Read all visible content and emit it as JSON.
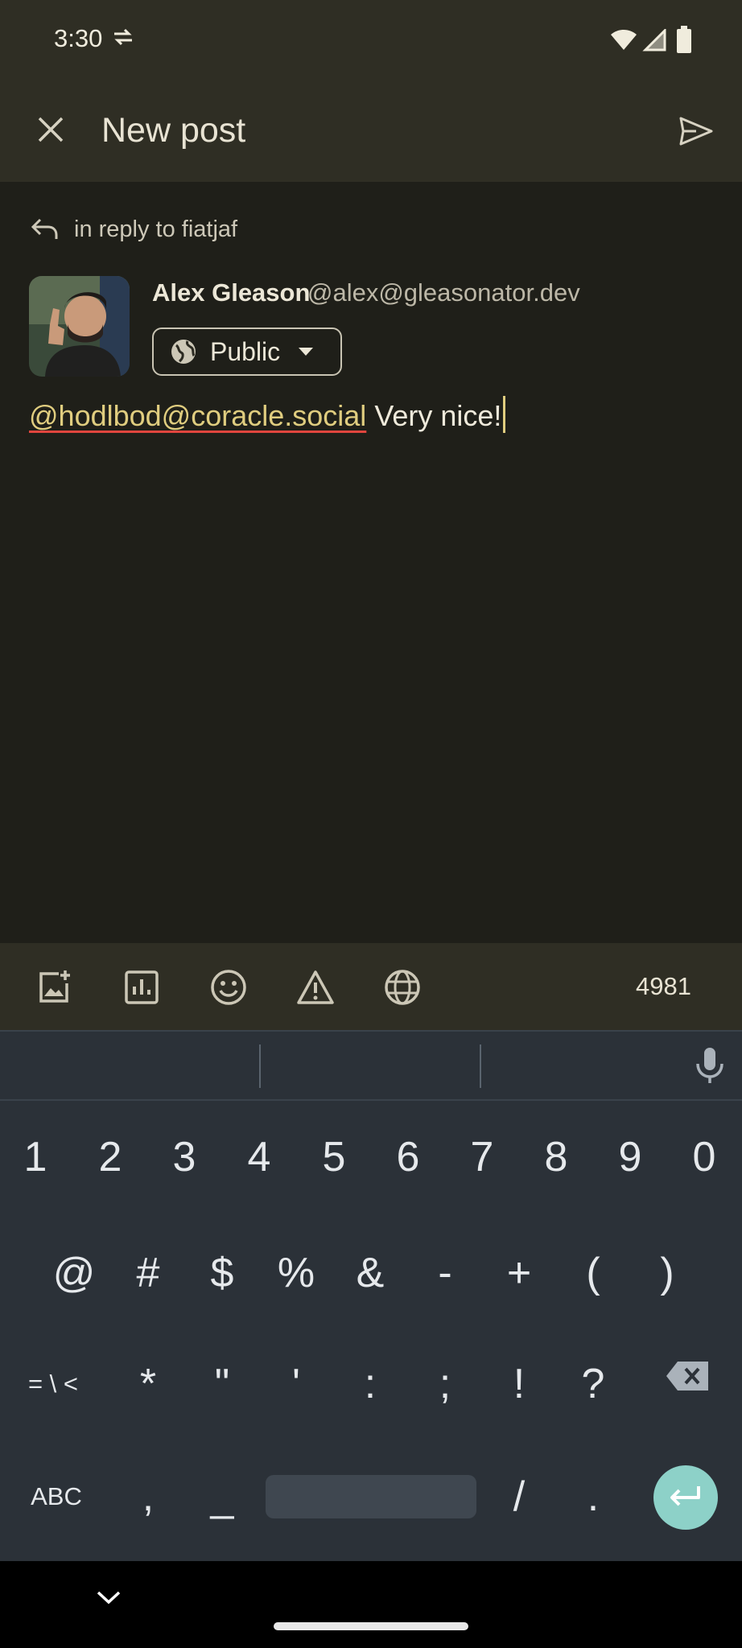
{
  "status_bar": {
    "time": "3:30"
  },
  "app_bar": {
    "title": "New post"
  },
  "compose": {
    "reply_label": "in reply to fiatjaf",
    "author_name": "Alex Gleason",
    "author_handle": "@alex@gleasonator.dev",
    "visibility": "Public",
    "mention": "@hodlbod@coracle.social",
    "text": " Very nice!"
  },
  "toolbar": {
    "char_count": "4981"
  },
  "keyboard": {
    "row1": [
      "1",
      "2",
      "3",
      "4",
      "5",
      "6",
      "7",
      "8",
      "9",
      "0"
    ],
    "row2": [
      "@",
      "#",
      "$",
      "%",
      "&",
      "-",
      "+",
      "(",
      ")"
    ],
    "row3": [
      "= \\ <",
      "*",
      "\"",
      "'",
      ":",
      ";",
      "!",
      "?"
    ],
    "row4_left": "ABC",
    "row4_comma": ",",
    "row4_underscore": "_",
    "row4_slash": "/",
    "row4_period": "."
  },
  "colors": {
    "accent": "#e0cd7f",
    "enter_key": "#8dd1c8",
    "appbar": "#2f2e24",
    "background": "#1f1f19",
    "keyboard": "#2b3138"
  }
}
